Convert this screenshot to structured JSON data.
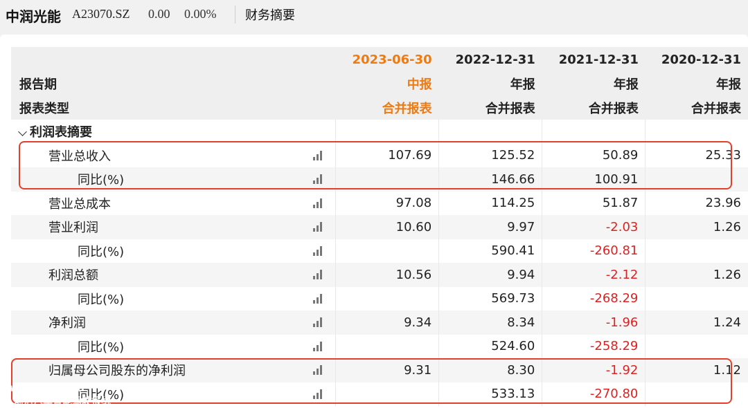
{
  "header": {
    "company_name": "中润光能",
    "stock_code": "A23070.SZ",
    "price": "0.00",
    "change_pct": "0.00%",
    "section_title": "财务摘要"
  },
  "table": {
    "period_label": "报告期",
    "type_label": "报表类型",
    "columns": [
      {
        "date": "2023-06-30",
        "period": "中报",
        "type": "合并报表"
      },
      {
        "date": "2022-12-31",
        "period": "年报",
        "type": "合并报表"
      },
      {
        "date": "2021-12-31",
        "period": "年报",
        "type": "合并报表"
      },
      {
        "date": "2020-12-31",
        "period": "年报",
        "type": "合并报表"
      }
    ],
    "section_label": "利润表摘要",
    "rows": [
      {
        "label": "营业总收入",
        "values": [
          "107.69",
          "125.52",
          "50.89",
          "25.33"
        ]
      },
      {
        "label": "同比(%)",
        "values": [
          "",
          "146.66",
          "100.91",
          ""
        ]
      },
      {
        "label": "营业总成本",
        "values": [
          "97.08",
          "114.25",
          "51.87",
          "23.96"
        ]
      },
      {
        "label": "营业利润",
        "values": [
          "10.60",
          "9.97",
          "-2.03",
          "1.26"
        ]
      },
      {
        "label": "同比(%)",
        "values": [
          "",
          "590.41",
          "-260.81",
          ""
        ]
      },
      {
        "label": "利润总额",
        "values": [
          "10.56",
          "9.94",
          "-2.12",
          "1.26"
        ]
      },
      {
        "label": "同比(%)",
        "values": [
          "",
          "569.73",
          "-268.29",
          ""
        ]
      },
      {
        "label": "净利润",
        "values": [
          "9.34",
          "8.34",
          "-1.96",
          "1.24"
        ]
      },
      {
        "label": "同比(%)",
        "values": [
          "",
          "524.60",
          "-258.29",
          ""
        ]
      },
      {
        "label": "归属母公司股东的净利润",
        "values": [
          "9.31",
          "8.30",
          "-1.92",
          "1.12"
        ]
      },
      {
        "label": "同比(%)",
        "values": [
          "",
          "533.13",
          "-270.80",
          ""
        ]
      }
    ]
  },
  "icons": {
    "chart": "bar-chart-icon",
    "expand": "chevron-down-icon"
  },
  "colors": {
    "accent": "#ee7a12",
    "negative": "#e02020",
    "highlight_box": "#e53e2a"
  },
  "watermark": {
    "line1": "www.car-meta",
    "line2": "前沿汽车智能驾驶报纸"
  }
}
